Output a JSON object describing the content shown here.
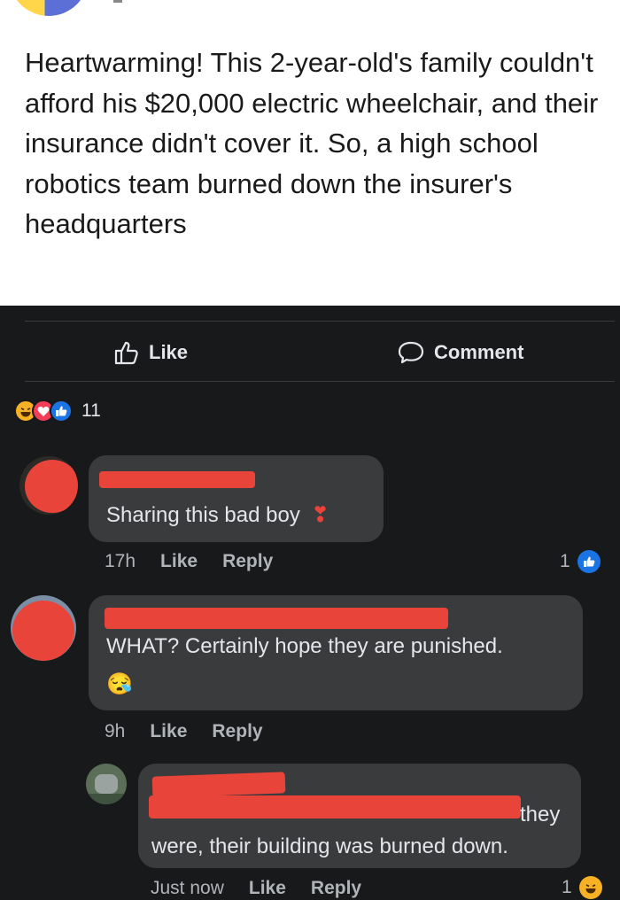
{
  "post": {
    "text": "Heartwarming! This 2-year-old's family couldn't afford his $20,000 electric wheelchair, and their insurance didn't cover it. So, a high school robotics team burned down the insurer's headquarters"
  },
  "actions": {
    "like_label": "Like",
    "comment_label": "Comment"
  },
  "reactions": {
    "icons": [
      "haha-icon",
      "love-icon",
      "like-icon"
    ],
    "count": "11"
  },
  "comments": [
    {
      "text": "Sharing this bad boy",
      "emoji": "❣",
      "time": "17h",
      "like_label": "Like",
      "reply_label": "Reply",
      "reaction_count": "1",
      "reaction_icon": "like-icon"
    },
    {
      "text": "WHAT? Certainly hope they are punished.",
      "emoji": "😪",
      "time": "9h",
      "like_label": "Like",
      "reply_label": "Reply"
    },
    {
      "text_line1": "they",
      "text_line2": "were, their building was burned down.",
      "time": "Just now",
      "like_label": "Like",
      "reply_label": "Reply",
      "reaction_count": "1",
      "reaction_icon": "haha-icon"
    }
  ],
  "colors": {
    "dark_background": "#18191a",
    "bubble": "#3a3b3c",
    "redaction": "#e8443a",
    "like_blue": "#1b74e4",
    "haha_yellow": "#f7b125",
    "love_red": "#f33e58"
  }
}
